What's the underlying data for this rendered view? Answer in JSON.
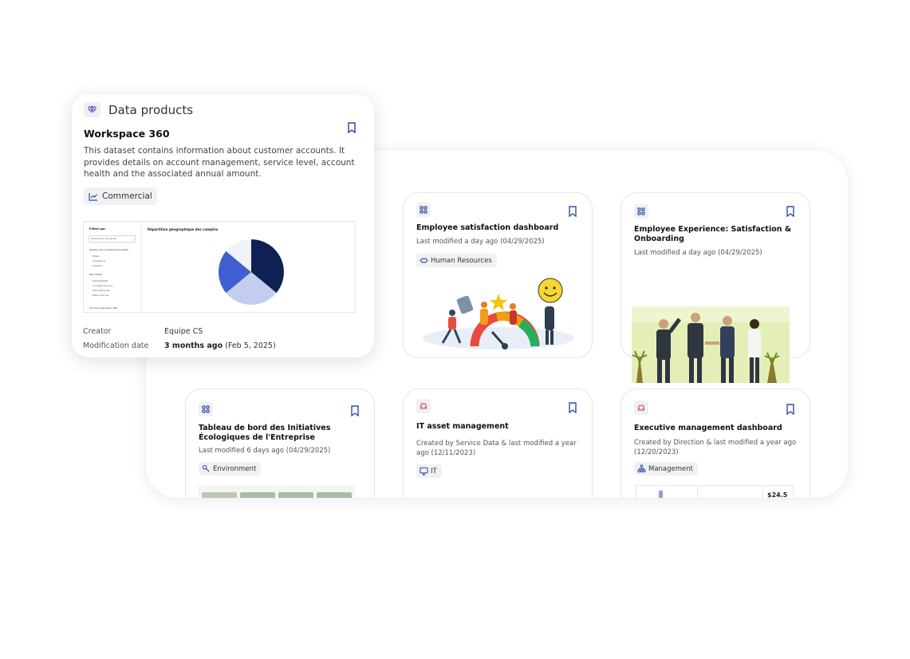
{
  "colors": {
    "accent": "#2f4f9f",
    "navy": "#0f2054",
    "royal": "#3f5fd0",
    "lavender": "#c5cdee",
    "pale": "#f1f2fb"
  },
  "front_card": {
    "section_label": "Data products",
    "title": "Workspace 360",
    "description": "This dataset contains information about customer accounts. It provides details on account management, service level, account health and the associated annual amount.",
    "tag": "Commercial",
    "creator_label": "Creator",
    "creator_value": "Equipe CS",
    "modified_label": "Modification date",
    "modified_relative": "3 months ago",
    "modified_date": "(Feb 5, 2025)",
    "preview": {
      "chart_title": "Répartition géographique des comptes",
      "filter_label": "Filtrer par",
      "selected_value": "Rechercher demande",
      "group1_label": "Gestion des comptes principales",
      "group1_items": [
        "Pilote",
        "Croissance",
        "Support"
      ],
      "group2_label": "Mon Noted",
      "group2_items": [
        "Administratif",
        "Comptes Service",
        "Mon demande",
        "Pleins Succès"
      ],
      "footer_label": "Account executive (AB)",
      "chart_data": {
        "type": "pie",
        "title": "Répartition géographique des comptes",
        "slices": [
          {
            "value": 36,
            "color": "#0f2054"
          },
          {
            "value": 28,
            "color": "#c5cdee"
          },
          {
            "value": 22,
            "color": "#3f5fd0"
          },
          {
            "value": 14,
            "color": "#f1f2fb"
          }
        ]
      }
    }
  },
  "cards": [
    {
      "title": "Employee satisfaction dashboard",
      "meta": "Last modified a day ago (04/29/2025)",
      "tag": "Human Resources"
    },
    {
      "title": "Employee Experience: Satisfaction & Onboarding",
      "meta": "Last modified a day ago (04/29/2025)"
    },
    {
      "title": "Tableau de bord des Initiatives Écologiques de l'Entreprise",
      "meta": "Last modified 6 days ago (04/29/2025)",
      "tag": "Environment"
    },
    {
      "title": "IT asset management",
      "meta": "Created by Service Data & last modified a year ago (12/11/2023)",
      "tag": "IT"
    },
    {
      "title": "Executive management dashboard",
      "meta": "Created by Direction & last modified a year ago (12/20/2023)",
      "tag": "Management",
      "preview_value": "$24.5"
    }
  ]
}
